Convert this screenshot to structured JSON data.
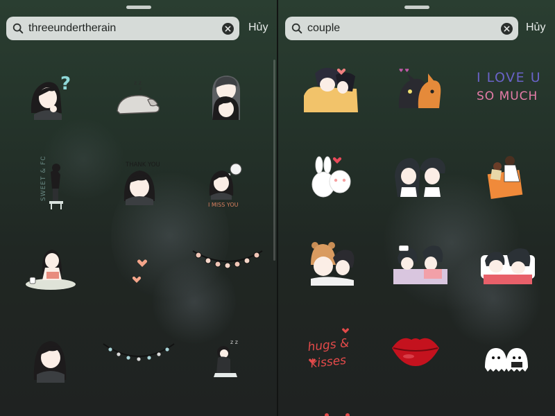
{
  "left_panel": {
    "search": {
      "query": "threeundertherain"
    },
    "cancel_label": "Hủy",
    "stickers": [
      {
        "name": "girl-question"
      },
      {
        "name": "sleeping-dog"
      },
      {
        "name": "couple-hug"
      },
      {
        "name": "sweet-and-food",
        "text": "SWEET & FOOD"
      },
      {
        "name": "thank-you-girl",
        "text": "THANK YOU"
      },
      {
        "name": "i-miss-you-girl",
        "text": "I MISS YOU"
      },
      {
        "name": "girl-reading"
      },
      {
        "name": "floating-hearts"
      },
      {
        "name": "heart-garland"
      },
      {
        "name": "girl-portrait"
      },
      {
        "name": "light-garland"
      },
      {
        "name": "sitting-girl"
      }
    ]
  },
  "right_panel": {
    "search": {
      "query": "couple"
    },
    "cancel_label": "Hủy",
    "stickers": [
      {
        "name": "couple-blanket"
      },
      {
        "name": "cat-couple"
      },
      {
        "name": "i-love-u-text",
        "line1": "I LOVE U",
        "line2": "SO MUCH"
      },
      {
        "name": "bunny-couple"
      },
      {
        "name": "couple-nose-touch"
      },
      {
        "name": "carry-couple"
      },
      {
        "name": "bear-hat-couple"
      },
      {
        "name": "bed-couple"
      },
      {
        "name": "couple-pillow"
      },
      {
        "name": "hugs-and-kisses",
        "line1": "hugs &",
        "line2": "kisses"
      },
      {
        "name": "red-lips"
      },
      {
        "name": "ghost-couple"
      }
    ]
  },
  "colors": {
    "heart": "#f08080",
    "lips": "#c4121e",
    "love_text": "#6a63c9",
    "much_text": "#e67ca8"
  }
}
